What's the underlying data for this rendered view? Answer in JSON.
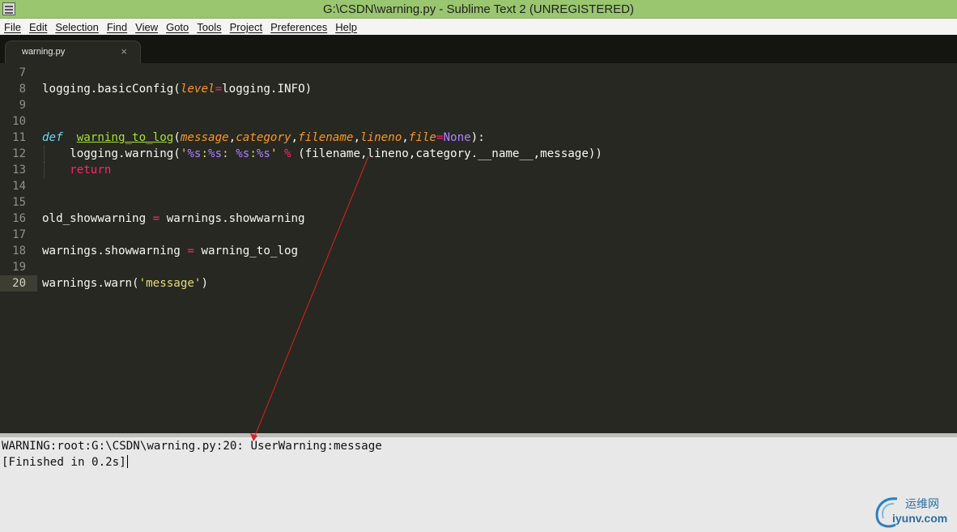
{
  "window": {
    "title": "G:\\CSDN\\warning.py - Sublime Text 2 (UNREGISTERED)"
  },
  "menu": [
    "File",
    "Edit",
    "Selection",
    "Find",
    "View",
    "Goto",
    "Tools",
    "Project",
    "Preferences",
    "Help"
  ],
  "tab": {
    "label": "warning.py",
    "close": "×"
  },
  "editor": {
    "current_line": "20",
    "lines": [
      {
        "num": "7"
      },
      {
        "num": "8"
      },
      {
        "num": "9"
      },
      {
        "num": "10"
      },
      {
        "num": "11"
      },
      {
        "num": "12"
      },
      {
        "num": "13"
      },
      {
        "num": "14"
      },
      {
        "num": "15"
      },
      {
        "num": "16"
      },
      {
        "num": "17"
      },
      {
        "num": "18"
      },
      {
        "num": "19"
      },
      {
        "num": "20"
      }
    ],
    "code": {
      "l8": {
        "a": "logging.basicConfig(",
        "b": "level",
        "c": "=",
        "d": "logging.INFO)"
      },
      "l11": {
        "def": "def",
        "fn": "warning_to_log",
        "p1": "message",
        "p2": "category",
        "p3": "filename",
        "p4": "lineno",
        "p5": "file",
        "eq": "=",
        "none": "None",
        "end": "):"
      },
      "l12": {
        "a": "logging.warning(",
        "q1": "'",
        "f1": "%s",
        "s1": ":",
        "f2": "%s",
        "s2": ": ",
        "f3": "%s",
        "s3": ":",
        "f4": "%s",
        "q2": "'",
        "pct": "%",
        "rest": " (filename,lineno,category.__name__,message))"
      },
      "l13": {
        "ret": "return"
      },
      "l16": {
        "a": "old_showwarning ",
        "eq": "=",
        "b": " warnings.showwarning"
      },
      "l18": {
        "a": "warnings.showwarning ",
        "eq": "=",
        "b": " warning_to_log"
      },
      "l20": {
        "a": "warnings.warn(",
        "s": "'message'",
        "b": ")"
      }
    }
  },
  "output": {
    "line1": "WARNING:root:G:\\CSDN\\warning.py:20: UserWarning:message",
    "line2": "[Finished in 0.2s]"
  },
  "watermark": {
    "cn": "运维网",
    "en": "iyunv.com"
  },
  "colors": {
    "background": "#272822",
    "keyword": "#f92672",
    "function": "#a6e22e",
    "parameter": "#fd971f",
    "string": "#e6db74",
    "constant": "#ae81ff",
    "storage": "#66d9ef",
    "arrow": "#e02020"
  }
}
